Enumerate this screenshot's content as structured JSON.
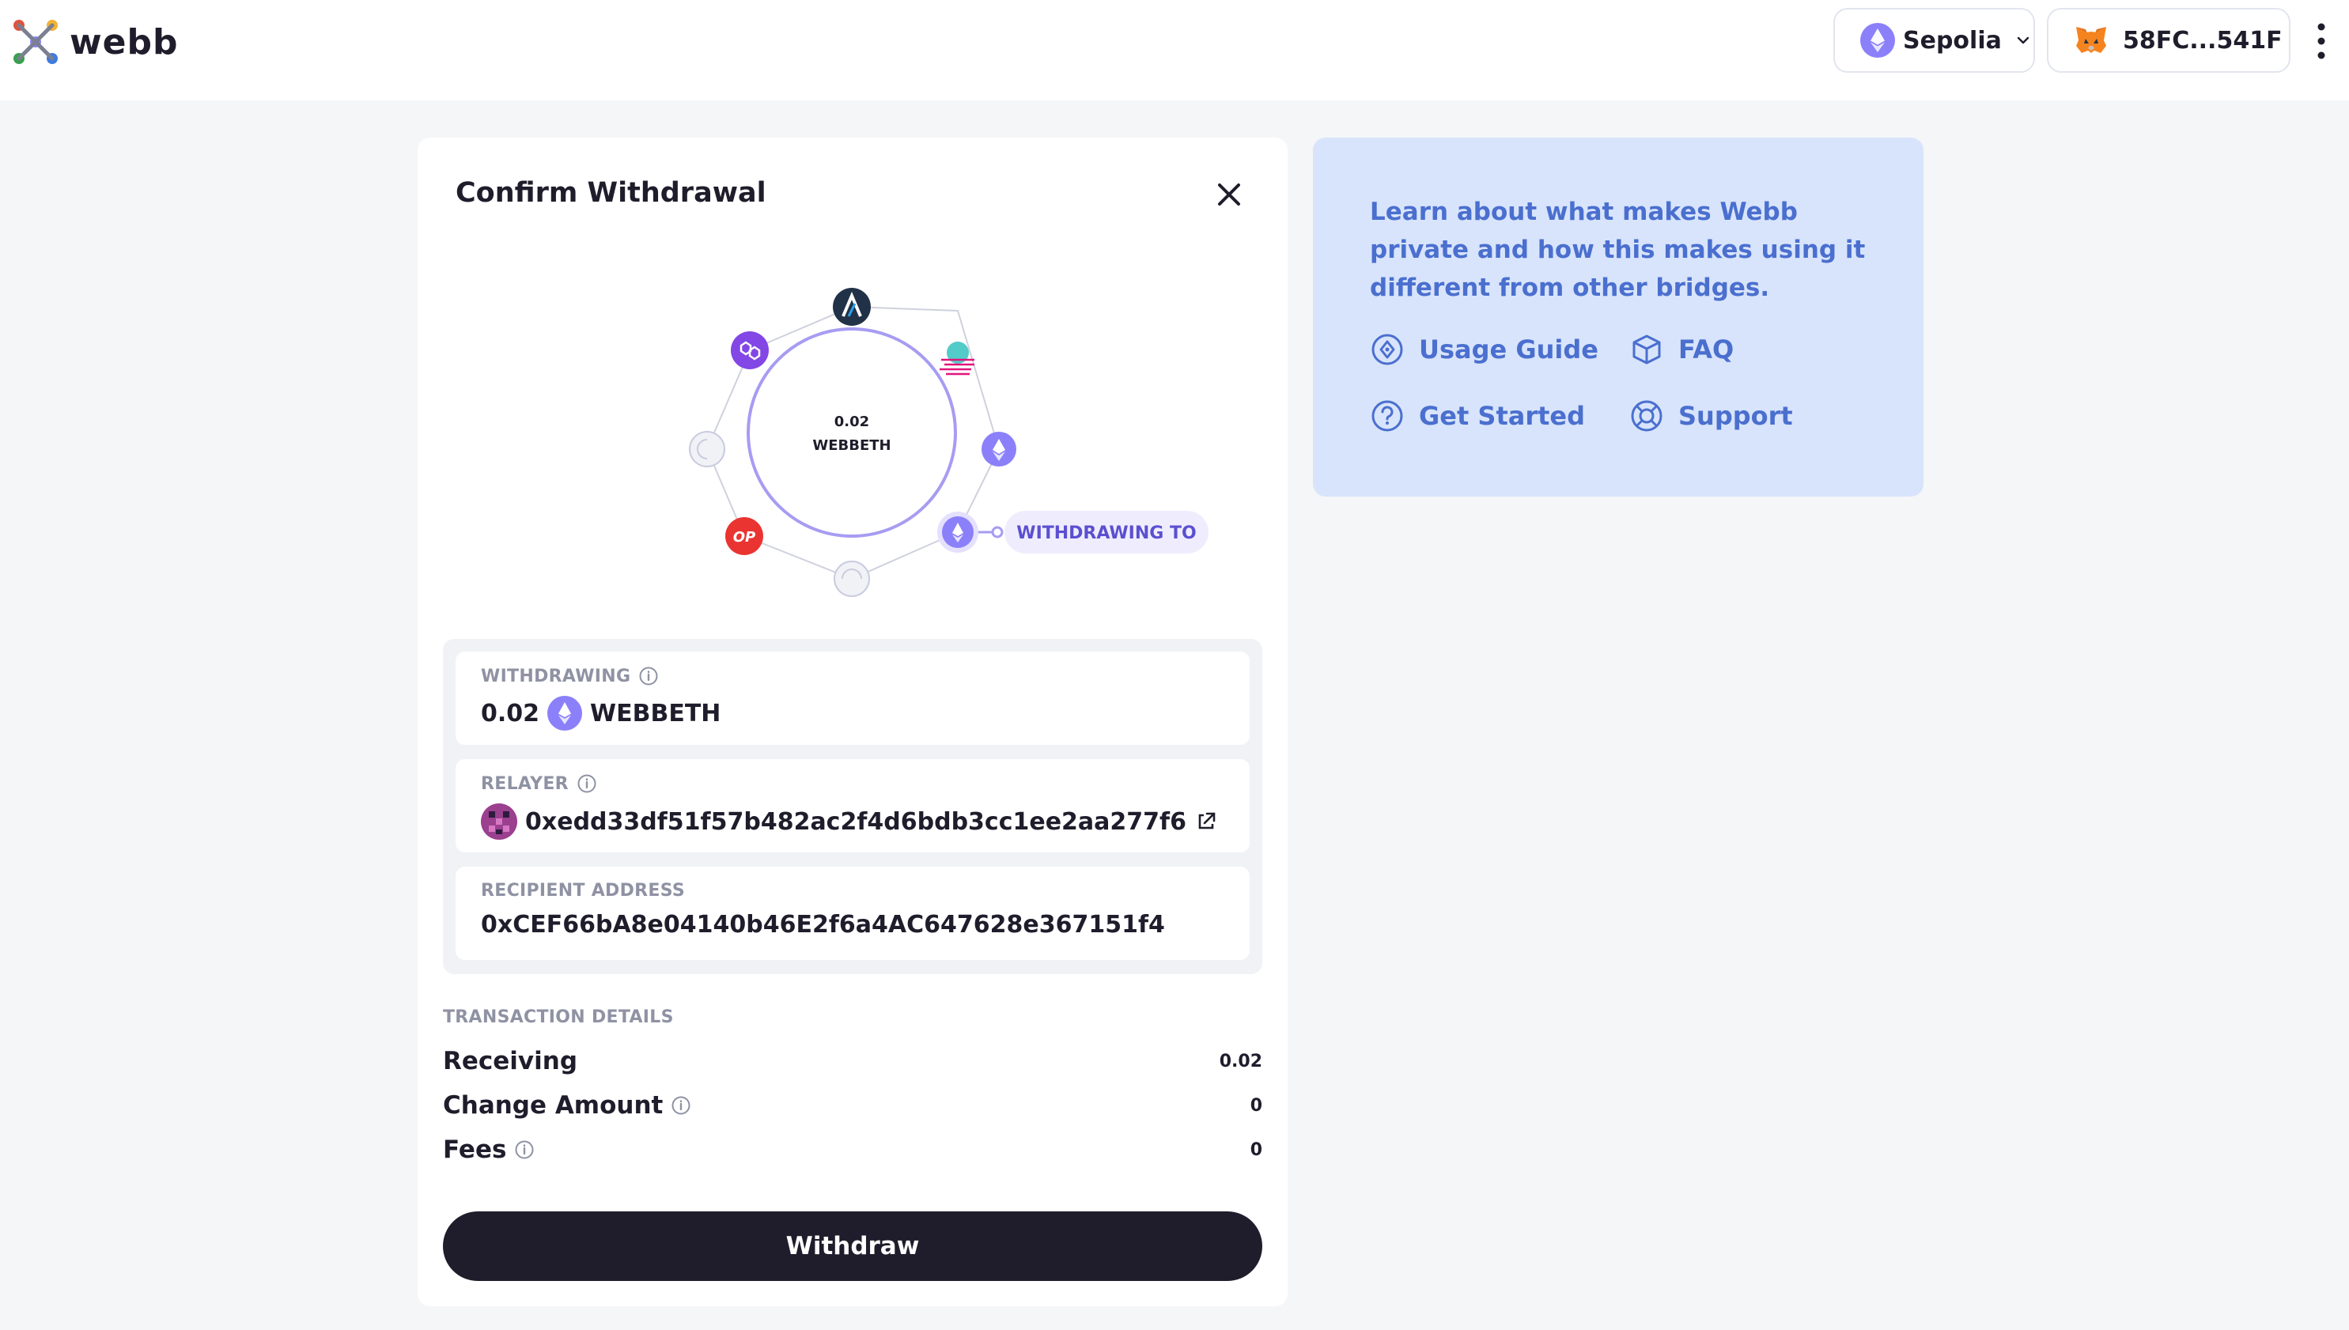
{
  "header": {
    "logo_text": "webb",
    "network": {
      "label": "Sepolia",
      "icon": "ethereum-icon",
      "accent": "#8b80f9"
    },
    "wallet": {
      "label": "58FC...541F",
      "icon": "metamask-fox-icon"
    },
    "menu_icon": "kebab-icon"
  },
  "modal": {
    "title": "Confirm Withdrawal",
    "close_icon": "close-icon",
    "diagram": {
      "amount": "0.02",
      "token": "WEBBETH",
      "withdrawing_to_label": "WITHDRAWING TO",
      "chains": [
        "arbitrum-icon",
        "moonbeam-icon",
        "ethereum-icon",
        "ethereum-icon",
        "placeholder-chain-icon",
        "optimism-icon",
        "placeholder-chain-icon",
        "polygon-icon"
      ],
      "optimism_text": "OP"
    },
    "withdrawing": {
      "label": "WITHDRAWING",
      "amount": "0.02",
      "token": "WEBBETH"
    },
    "relayer": {
      "label": "RELAYER",
      "address": "0xedd33df51f57b482ac2f4d6bdb3cc1ee2aa277f6"
    },
    "recipient": {
      "label": "RECIPIENT ADDRESS",
      "address": "0xCEF66bA8e04140b46E2f6a4AC647628e367151f4"
    },
    "transaction_details": {
      "title": "TRANSACTION DETAILS",
      "rows": [
        {
          "label": "Receiving",
          "value": "0.02"
        },
        {
          "label": "Change Amount",
          "value": "0"
        },
        {
          "label": "Fees",
          "value": "0"
        }
      ]
    },
    "withdraw_button": "Withdraw"
  },
  "info_card": {
    "text": "Learn about what makes Webb private and how this makes using it different from other bridges.",
    "links": [
      {
        "label": "Usage Guide",
        "icon": "compass-icon"
      },
      {
        "label": "FAQ",
        "icon": "box-icon"
      },
      {
        "label": "Get Started",
        "icon": "question-circle-icon"
      },
      {
        "label": "Support",
        "icon": "lifebuoy-icon"
      }
    ]
  },
  "colors": {
    "accent_purple": "#8b80f9",
    "dark": "#1f1d2b",
    "info_blue": "#4a6fcf",
    "info_bg": "#d8e4fb"
  }
}
